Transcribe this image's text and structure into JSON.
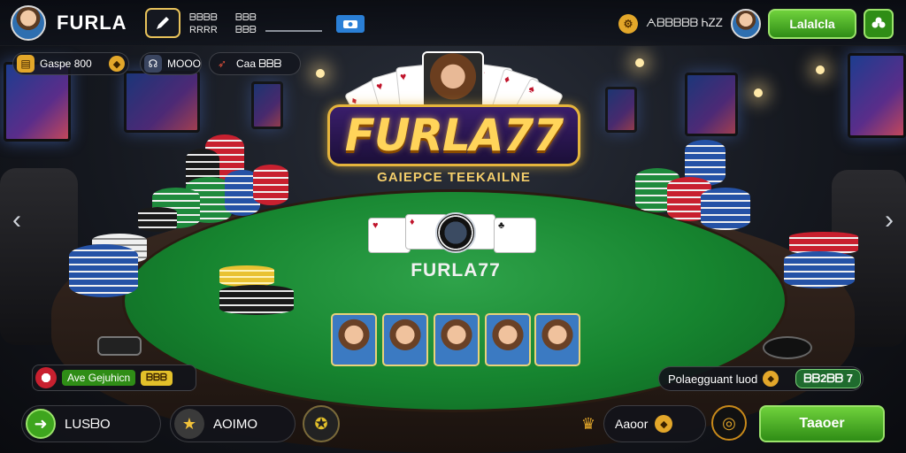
{
  "header": {
    "brand": "FURLA",
    "stat_line1_a": "ᗷᗷᗷᗷ",
    "stat_line2_a": "RRRR",
    "stat_line1_b": "ᗷᗷᗷ",
    "stat_line2_b": "ᗷᗷᗷ",
    "balance": "ᗅᗷᗷᗷᗷᗷ ᏂᏃᏃ",
    "primary_button": "Lalalcla"
  },
  "subbar": {
    "coins_label": "Gaspe 800",
    "mode_label": "MOOO",
    "promo_label": "Caa ᗷᗷᗷ"
  },
  "logo": {
    "title": "FURLA77",
    "subtitle": "GAIEPCE TEEKAILNE"
  },
  "table": {
    "felt_brand": "FURLA77"
  },
  "side_panel_left": {
    "label": "Ave Gejuhicn",
    "value": "ᗷᗷᗷ"
  },
  "side_panel_right": {
    "label": "Polaegguant luod",
    "value": "ᗷᗷ2ᗷᗷ 7"
  },
  "bottom": {
    "back_label": "LUSᗷO",
    "star_label": "AOIMO",
    "gold_label": "Aaoor",
    "play_button": "Taaoer"
  },
  "colors": {
    "accent_green": "#3ea51e",
    "felt": "#16842f",
    "gold": "#e5b43c",
    "chip_red": "#c8202f",
    "chip_blue": "#2552a6"
  }
}
